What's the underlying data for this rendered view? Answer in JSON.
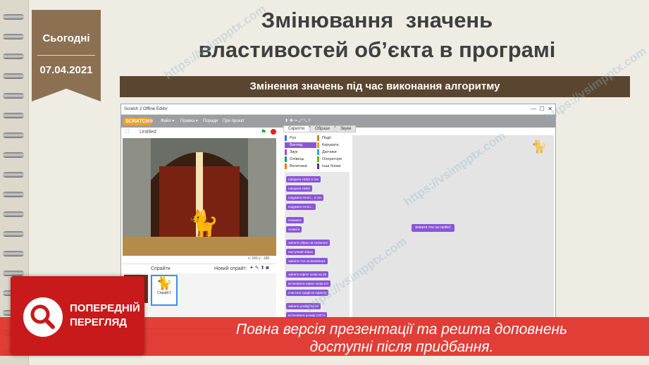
{
  "date": {
    "today_label": "Сьогодні",
    "date_value": "07.04.2021"
  },
  "slide": {
    "title_line1": "Змінювання  значень",
    "title_line2": "властивостей об’єкта в програмі",
    "subtitle": "Змінення значень під час виконання алгоритму"
  },
  "scratch": {
    "window_title": "Scratch 2 Offline Editor",
    "menu": {
      "logo": "SCRATCH",
      "file": "Файл ▾",
      "edit": "Правка ▾",
      "tips": "Поради",
      "about": "Про проєкт"
    },
    "stage_name": "Untitled",
    "coords": "x: 240  y: -180",
    "sprites_label": "Спрайти",
    "new_sprite_label": "Новий спрайт:",
    "sprite_name": "Спрайт1",
    "tabs": [
      "Скрипти",
      "Образи",
      "Звуки"
    ],
    "categories": [
      "Рух",
      "Вигляд",
      "Звук",
      "Олівець",
      "Величини",
      "Події",
      "Керувати",
      "Датчики",
      "Оператори",
      "Інші блоки"
    ],
    "blocks": [
      "говорити Hello! 2 сек",
      "говорити Hello!",
      "подумати Hmm... 2 сек",
      "подумати Hmm...",
      "показати",
      "сховати",
      "змінити образ на costume2",
      "наступний образ",
      "змінити тло на backdrop1",
      "змінити ефект колір на 25",
      "встановити ефект колір в 0",
      "очистити графічні ефекти",
      "змінити розмір на 10",
      "встановити розмір 100 %"
    ],
    "script_block": "змінити тло на castle1",
    "colors": {
      "looks": "#8a55d7",
      "menubar": "#9c9ea2"
    }
  },
  "banner": {
    "preview_label_line1": "ПОПЕРЕДНІЙ",
    "preview_label_line2": "ПЕРЕГЛЯД",
    "message_line1": "Повна версія презентації та решта доповнень",
    "message_line2": "доступні після придбання."
  },
  "watermark_text": "https://vsimpptx.com"
}
